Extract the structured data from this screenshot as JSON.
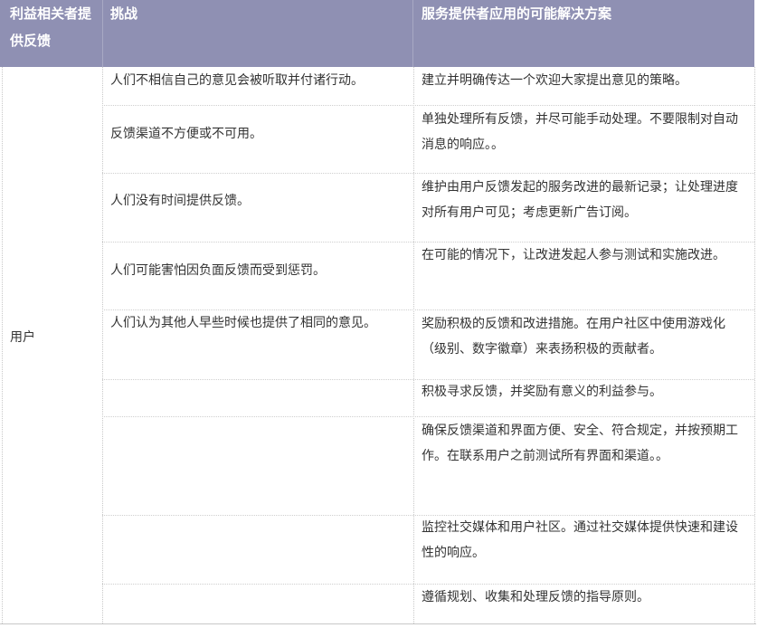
{
  "table": {
    "headers": {
      "stakeholder": "利益相关者提供反馈",
      "challenge": "挑战",
      "solution": "服务提供者应用的可能解决方案"
    },
    "stakeholder": "用户",
    "rows": [
      {
        "challenge": "人们不相信自己的意见会被听取并付诸行动。",
        "solution": "建立并明确传达一个欢迎大家提出意见的策略。"
      },
      {
        "challenge": "反馈渠道不方便或不可用。",
        "solution": "单独处理所有反馈，并尽可能手动处理。不要限制对自动消息的响应。。"
      },
      {
        "challenge": "人们没有时间提供反馈。",
        "solution": "维护由用户反馈发起的服务改进的最新记录；让处理进度对所有用户可见；考虑更新广告订阅。"
      },
      {
        "challenge": "人们可能害怕因负面反馈而受到惩罚。",
        "solution": "在可能的情况下，让改进发起人参与测试和实施改进。"
      },
      {
        "challenge": "人们认为其他人早些时候也提供了相同的意见。",
        "solution": "奖励积极的反馈和改进措施。在用户社区中使用游戏化（级别、数字徽章）来表扬积极的贡献者。"
      },
      {
        "challenge": "",
        "solution": "积极寻求反馈，并奖励有意义的利益参与。"
      },
      {
        "challenge": "",
        "solution": "确保反馈渠道和界面方便、安全、符合规定，并按预期工作。在联系用户之前测试所有界面和渠道。。"
      },
      {
        "challenge": "",
        "solution": "监控社交媒体和用户社区。通过社交媒体提供快速和建设性的响应。"
      },
      {
        "challenge": "",
        "solution": "遵循规划、收集和处理反馈的指导原则。"
      }
    ]
  }
}
